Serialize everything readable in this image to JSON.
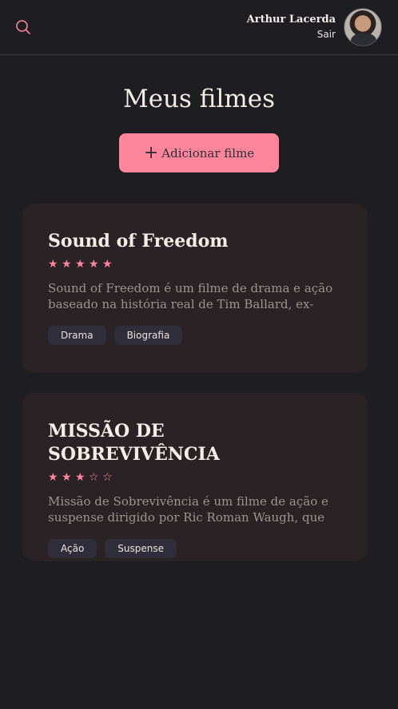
{
  "header": {
    "search_icon": "search-icon",
    "user_name": "Arthur Lacerda",
    "logout_label": "Sair"
  },
  "main": {
    "title": "Meus filmes",
    "add_button_label": "Adicionar filme",
    "movies": [
      {
        "title": "Sound of Freedom",
        "rating": 5,
        "stars": "★ ★ ★ ★ ★",
        "description": "Sound of Freedom é um filme de drama e ação baseado na história real de Tim Ballard, ex-",
        "tags": [
          "Drama",
          "Biografia"
        ]
      },
      {
        "title": "MISSÃO DE SOBREVIVÊNCIA",
        "rating": 3,
        "stars": "★ ★ ★ ☆ ☆",
        "description": "Missão de Sobrevivência é um filme de ação e suspense dirigido por Ric Roman Waugh, que",
        "tags": [
          "Ação",
          "Suspense"
        ]
      }
    ]
  },
  "colors": {
    "accent": "#ff859b",
    "background": "#1e1d21",
    "card": "#2a2224",
    "tag": "#312e3b"
  }
}
